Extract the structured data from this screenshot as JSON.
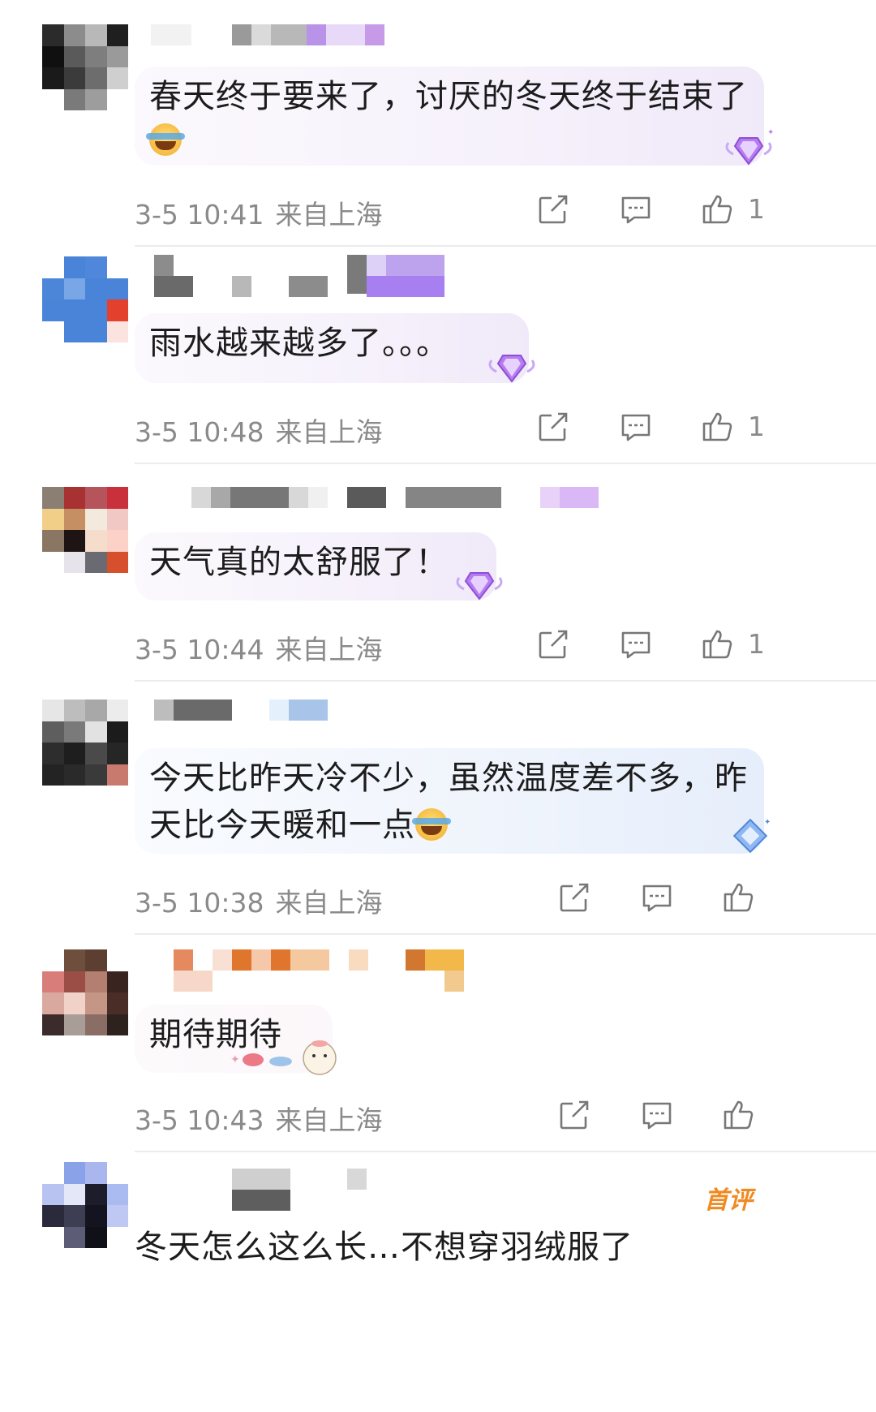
{
  "comments": [
    {
      "text": "春天终于要来了，讨厌的冬天终于结束了",
      "has_emoji": true,
      "time": "3-5 10:41",
      "location": "来自上海",
      "likes": "1",
      "avatar_colors": [
        "#2b2b2b",
        "#8c8c8c",
        "#b8b8b8",
        "#1f1f1f",
        "#101010",
        "#5a5a5a",
        "#7e7e7e",
        "#9a9a9a",
        "#1a1a1a",
        "#3b3b3b",
        "#6d6d6d",
        "#cfcfcf",
        "#ffffff",
        "#7a7a7a",
        "#9d9d9d",
        "#ffffff"
      ]
    },
    {
      "text": "雨水越来越多了。。。",
      "has_emoji": false,
      "time": "3-5 10:48",
      "location": "来自上海",
      "likes": "1",
      "avatar_colors": [
        "#ffffff",
        "#4a84d8",
        "#4f88da",
        "#ffffff",
        "#4c86d9",
        "#78a6e6",
        "#4a84d8",
        "#4a84d8",
        "#4a84d8",
        "#4a84d8",
        "#4a84d8",
        "#e3402d",
        "#ffffff",
        "#4a84d8",
        "#4a84d8",
        "#fbe4df"
      ]
    },
    {
      "text": "天气真的太舒服了！",
      "has_emoji": false,
      "time": "3-5 10:44",
      "location": "来自上海",
      "likes": "1",
      "avatar_colors": [
        "#8b7f74",
        "#a83232",
        "#b5545a",
        "#c8303c",
        "#f1cf88",
        "#c58e63",
        "#f4e9dd",
        "#f2c8c4",
        "#8a7662",
        "#1e1414",
        "#f6dccb",
        "#fbd1c8",
        "#ffffff",
        "#e7e3ea",
        "#6a6a73",
        "#d6502e"
      ]
    },
    {
      "text": "今天比昨天冷不少，虽然温度差不多，昨天比今天暖和一点",
      "has_emoji": true,
      "time": "3-5 10:38",
      "location": "来自上海",
      "likes": "",
      "avatar_colors": [
        "#e6e6e6",
        "#bdbdbd",
        "#a8a8a8",
        "#ececec",
        "#5e5e5e",
        "#7a7a7a",
        "#e2e2e2",
        "#1b1b1b",
        "#2d2d2d",
        "#1e1e1e",
        "#4a4a4a",
        "#262626",
        "#232323",
        "#2a2a2a",
        "#3a3a3a",
        "#c87a6e"
      ]
    },
    {
      "text": "期待期待",
      "has_emoji": false,
      "time": "3-5 10:43",
      "location": "来自上海",
      "likes": "",
      "avatar_colors": [
        "#ffffff",
        "#6e4e3c",
        "#5d3f32",
        "#ffffff",
        "#d87d7a",
        "#9a4e46",
        "#b47f70",
        "#3a2420",
        "#d9a89e",
        "#f1d2c8",
        "#c59585",
        "#4a2d27",
        "#3b2b2b",
        "#a89d97",
        "#8a6e66",
        "#2e221f"
      ]
    },
    {
      "text": "冬天怎么这么长…不想穿羽绒服了",
      "has_emoji": false,
      "time": "",
      "location": "",
      "likes": "",
      "first_tag": "首评",
      "avatar_colors": [
        "#ffffff",
        "#8aa2e8",
        "#a9b7ee",
        "#ffffff",
        "#b8c3f2",
        "#e4e7f8",
        "#1c1c2a",
        "#a9bbf0",
        "#2a2a3c",
        "#3e3e52",
        "#141420",
        "#bfc8f3",
        "#ffffff",
        "#5c5c77",
        "#101018",
        "#ffffff"
      ]
    }
  ],
  "icons": {
    "share": "share-icon",
    "comment": "comment-icon",
    "like": "thumbs-up-icon",
    "badge": "diamond-vip-badge-icon"
  },
  "colors": {
    "meta_text": "#8a8a8a",
    "first_tag": "#f08a22",
    "divider": "#ececec"
  }
}
